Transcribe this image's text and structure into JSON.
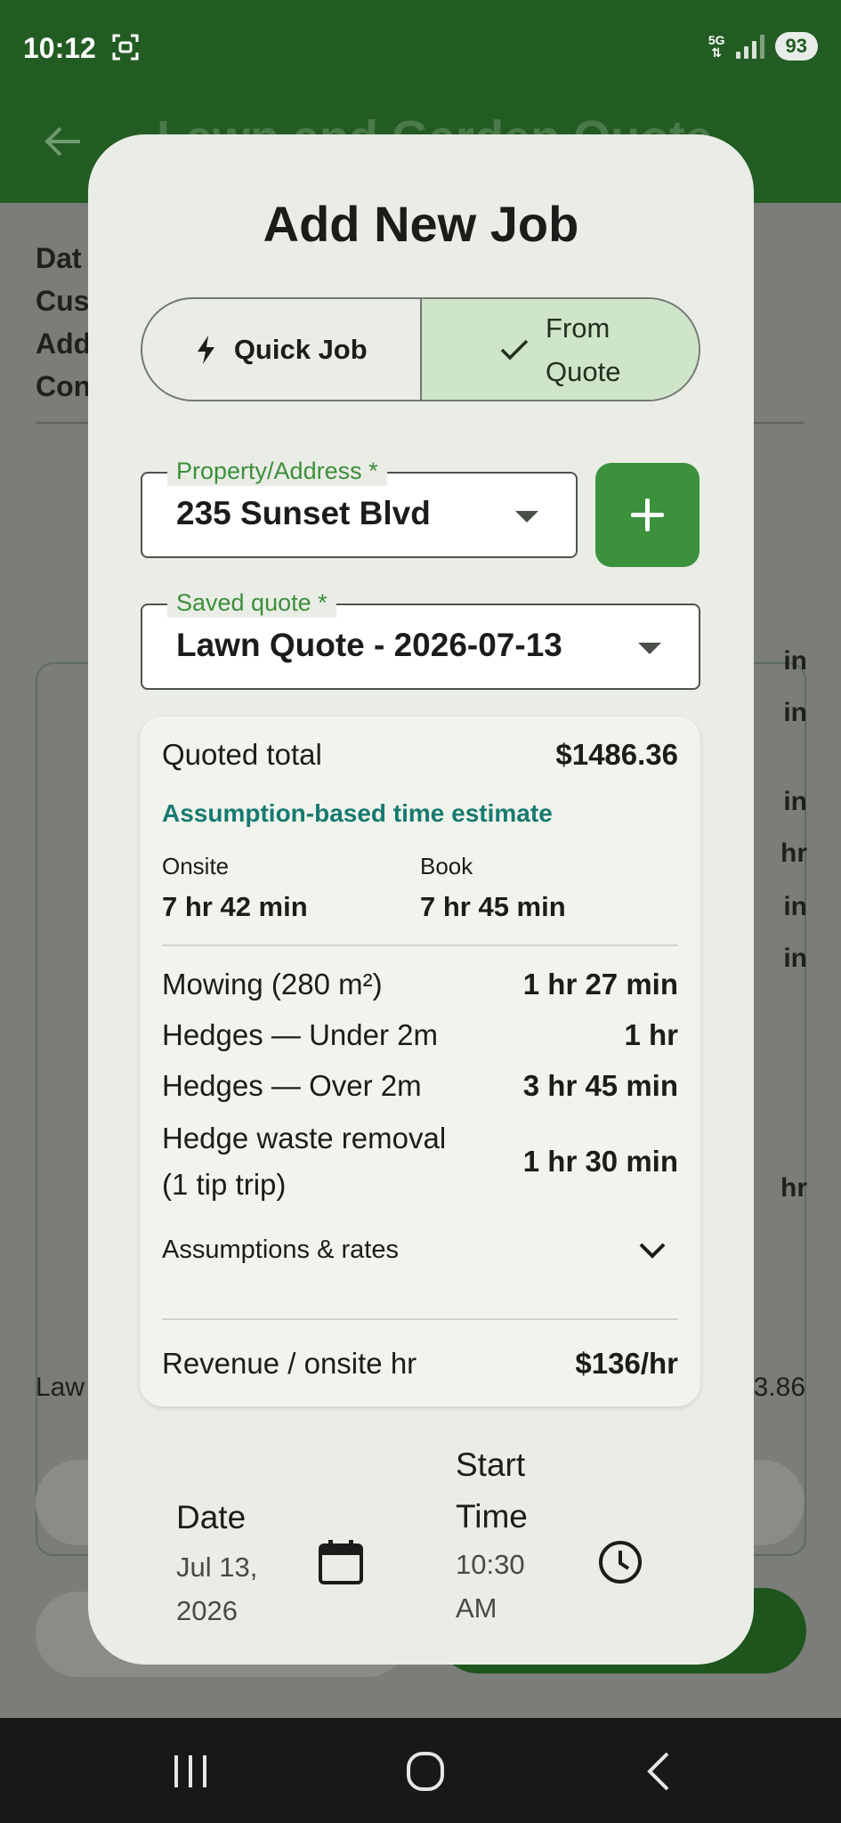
{
  "status_bar": {
    "time": "10:12",
    "network": "5G",
    "battery": "93"
  },
  "app_bar": {
    "title": "Lawn and Garden Quote"
  },
  "background": {
    "labels": [
      "Dat",
      "Cus",
      "Add",
      "Con"
    ],
    "side_values": [
      "in",
      "in",
      "in",
      "hr",
      "in",
      "in",
      "hr"
    ],
    "footer_left": "Law",
    "footer_right": "3.86"
  },
  "dialog": {
    "title": "Add New Job",
    "mode_toggle": {
      "quick_job": "Quick Job",
      "from_quote_line1": "From",
      "from_quote_line2": "Quote",
      "selected": "From Quote"
    },
    "property": {
      "label": "Property/Address *",
      "value": "235 Sunset Blvd"
    },
    "saved_quote": {
      "label": "Saved quote *",
      "value": "Lawn Quote - 2026-07-13"
    },
    "quote_card": {
      "quoted_total_label": "Quoted total",
      "quoted_total_value": "$1486.36",
      "estimate_heading": "Assumption-based time estimate",
      "onsite_label": "Onsite",
      "onsite_value": "7 hr 42 min",
      "book_label": "Book",
      "book_value": "7 hr 45 min",
      "tasks": [
        {
          "label": "Mowing (280 m²)",
          "value": "1 hr 27 min"
        },
        {
          "label": "Hedges — Under 2m",
          "value": "1 hr"
        },
        {
          "label": "Hedges — Over 2m",
          "value": "3 hr 45 min"
        },
        {
          "label_line1": "Hedge waste removal",
          "label_line2": "(1 tip trip)",
          "value": "1 hr 30 min"
        }
      ],
      "assumptions_label": "Assumptions & rates",
      "revenue_label": "Revenue / onsite hr",
      "revenue_value": "$136/hr"
    },
    "schedule": {
      "date_label": "Date",
      "date_value_line1": "Jul 13,",
      "date_value_line2": "2026",
      "time_label_line1": "Start",
      "time_label_line2": "Time",
      "time_value_line1": "10:30",
      "time_value_line2": "AM"
    }
  }
}
